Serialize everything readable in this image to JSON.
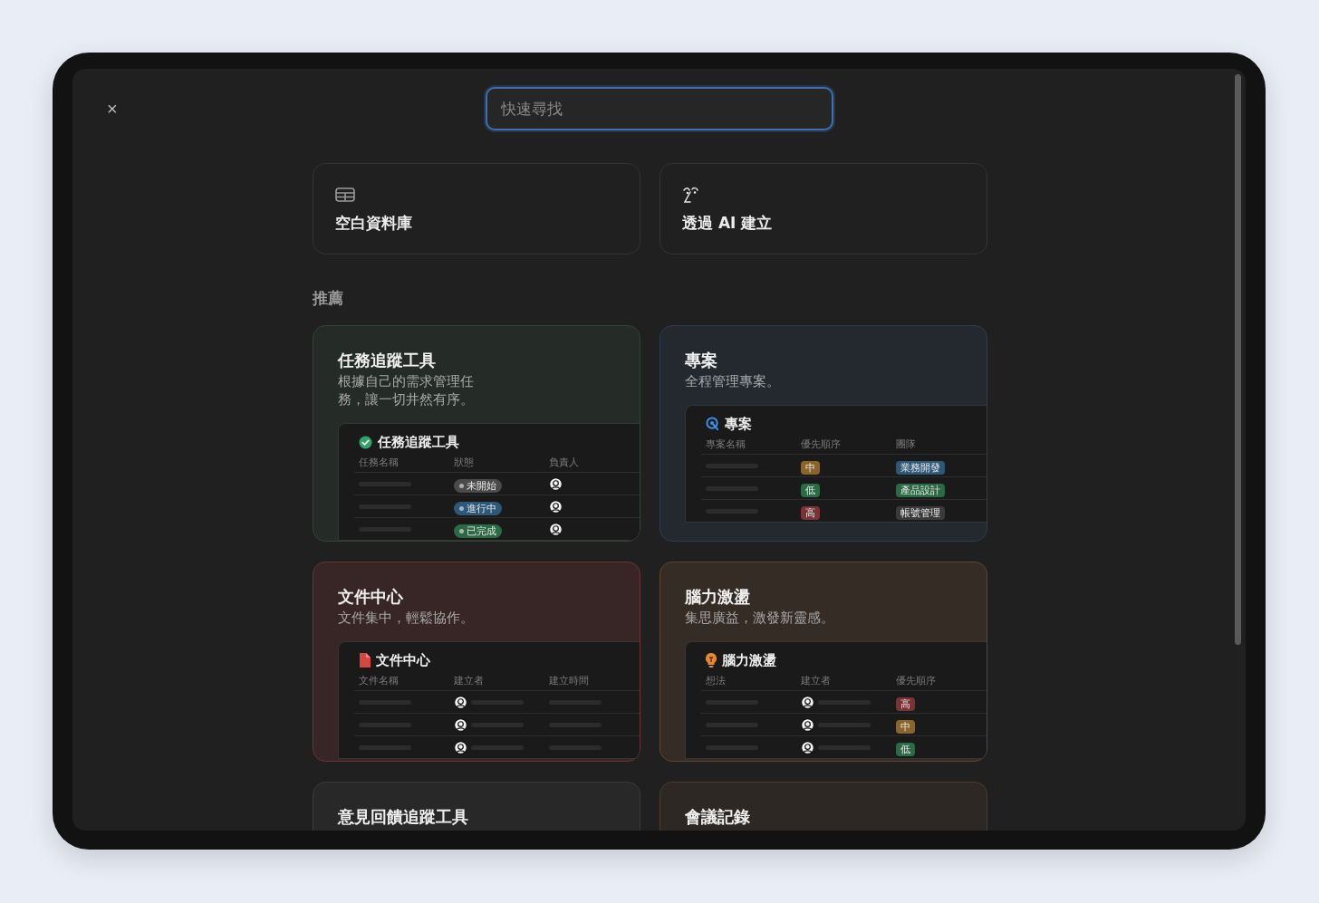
{
  "close_button": {
    "label": "×"
  },
  "search": {
    "placeholder": "快速尋找"
  },
  "actions": [
    {
      "kind": "table",
      "label": "空白資料庫"
    },
    {
      "kind": "ai",
      "label": "透過 AI 建立"
    }
  ],
  "section_title": "推薦",
  "templates": [
    {
      "title": "任務追蹤工具",
      "description": "根據自己的需求管理任務，讓一切井然有序。",
      "color": "#2f4636",
      "preview": {
        "kind": "check",
        "title": "任務追蹤工具",
        "columns": [
          "任務名稱",
          "狀態",
          "負責人"
        ],
        "rows": [
          {
            "cells": [
              {
                "kind": "bar"
              },
              {
                "kind": "tag",
                "text": "未開始",
                "color": "#4a4a4a",
                "dot": true
              },
              {
                "kind": "avatar"
              }
            ]
          },
          {
            "cells": [
              {
                "kind": "bar"
              },
              {
                "kind": "tag",
                "text": "進行中",
                "color": "#2d5878",
                "dot": true
              },
              {
                "kind": "avatar"
              }
            ]
          },
          {
            "cells": [
              {
                "kind": "bar"
              },
              {
                "kind": "tag",
                "text": "已完成",
                "color": "#2b6a44",
                "dot": true
              },
              {
                "kind": "avatar"
              }
            ]
          }
        ]
      }
    },
    {
      "title": "專案",
      "description": "全程管理專案。",
      "color": "#2c3c52",
      "preview": {
        "kind": "target",
        "title": "專案",
        "columns": [
          "專案名稱",
          "優先順序",
          "團隊"
        ],
        "rows": [
          {
            "cells": [
              {
                "kind": "bar"
              },
              {
                "kind": "tag",
                "text": "中",
                "color": "#8a6428",
                "dot": false
              },
              {
                "kind": "tag",
                "text": "業務開發",
                "color": "#2d5878",
                "dot": false
              }
            ]
          },
          {
            "cells": [
              {
                "kind": "bar"
              },
              {
                "kind": "tag",
                "text": "低",
                "color": "#2b6a44",
                "dot": false
              },
              {
                "kind": "tag",
                "text": "產品設計",
                "color": "#2b6a44",
                "dot": false
              }
            ]
          },
          {
            "cells": [
              {
                "kind": "bar"
              },
              {
                "kind": "tag",
                "text": "高",
                "color": "#7a3333",
                "dot": false
              },
              {
                "kind": "tag",
                "text": "帳號管理",
                "color": "#3a3a3a",
                "dot": false
              }
            ]
          }
        ]
      }
    },
    {
      "title": "文件中心",
      "description": "文件集中，輕鬆協作。",
      "color": "#6a3434",
      "preview": {
        "kind": "file",
        "title": "文件中心",
        "columns": [
          "文件名稱",
          "建立者",
          "建立時間"
        ],
        "rows": [
          {
            "cells": [
              {
                "kind": "bar"
              },
              {
                "kind": "avatar"
              },
              {
                "kind": "bar"
              }
            ]
          },
          {
            "cells": [
              {
                "kind": "bar"
              },
              {
                "kind": "avatar"
              },
              {
                "kind": "bar"
              }
            ]
          },
          {
            "cells": [
              {
                "kind": "bar"
              },
              {
                "kind": "avatar"
              },
              {
                "kind": "bar"
              }
            ]
          }
        ]
      }
    },
    {
      "title": "腦力激盪",
      "description": "集思廣益，激發新靈感。",
      "color": "#5e4530",
      "preview": {
        "kind": "bulb",
        "title": "腦力激盪",
        "columns": [
          "想法",
          "建立者",
          "優先順序"
        ],
        "rows": [
          {
            "cells": [
              {
                "kind": "bar"
              },
              {
                "kind": "avatar"
              },
              {
                "kind": "tag",
                "text": "高",
                "color": "#7a3333",
                "dot": false
              }
            ]
          },
          {
            "cells": [
              {
                "kind": "bar"
              },
              {
                "kind": "avatar"
              },
              {
                "kind": "tag",
                "text": "中",
                "color": "#8a6428",
                "dot": false
              }
            ]
          },
          {
            "cells": [
              {
                "kind": "bar"
              },
              {
                "kind": "avatar"
              },
              {
                "kind": "tag",
                "text": "低",
                "color": "#2b6a44",
                "dot": false
              }
            ]
          }
        ]
      }
    },
    {
      "title": "意見回饋追蹤工具",
      "color": "#3a3a3a"
    },
    {
      "title": "會議記錄",
      "color": "#4a3a2c"
    }
  ]
}
